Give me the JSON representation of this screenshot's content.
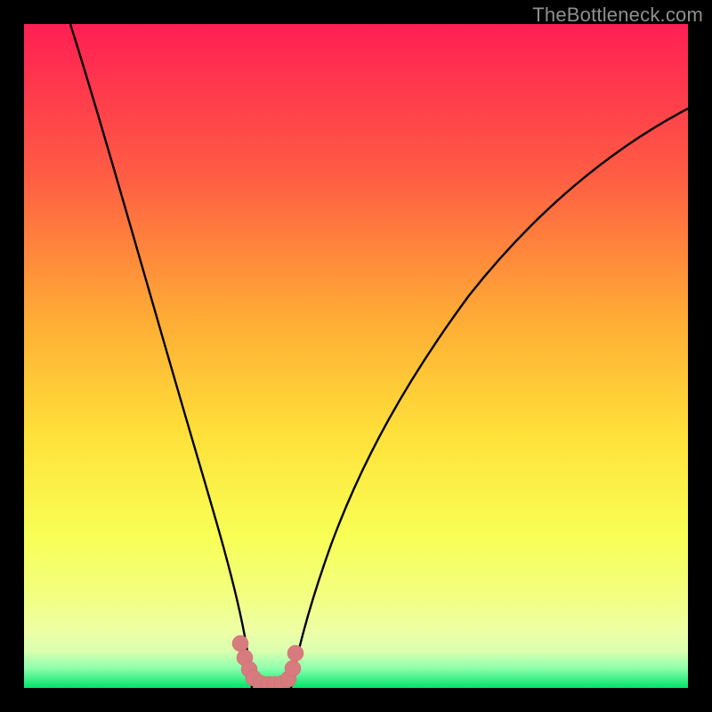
{
  "watermark": "TheBottleneck.com",
  "chart_data": {
    "type": "line",
    "title": "",
    "xlabel": "",
    "ylabel": "",
    "xlim": [
      0,
      100
    ],
    "ylim": [
      0,
      100
    ],
    "series": [
      {
        "name": "left-curve",
        "x": [
          7,
          10,
          14,
          18,
          22,
          25,
          27,
          29,
          30.5,
          31.5,
          32.3,
          33,
          33.5,
          34
        ],
        "y": [
          100,
          90,
          76,
          62,
          47,
          35,
          27,
          19,
          13,
          9,
          6,
          4,
          2.5,
          0
        ]
      },
      {
        "name": "right-curve",
        "x": [
          40,
          41,
          43,
          46,
          50,
          56,
          64,
          74,
          85,
          95,
          100
        ],
        "y": [
          0,
          3,
          10,
          20,
          32,
          46,
          60,
          72,
          80,
          85,
          88
        ]
      },
      {
        "name": "trough-markers",
        "type": "scatter",
        "x": [
          32.5,
          33.2,
          33.9,
          34.6,
          35.6,
          36.8,
          37.8,
          38.8,
          39.8,
          40.5,
          40.8
        ],
        "y": [
          6.8,
          4.6,
          2.8,
          1.4,
          0.6,
          0.5,
          0.5,
          0.6,
          1.3,
          3.0,
          5.2
        ]
      }
    ],
    "colors": {
      "curve": "#000000",
      "markers": "#d87b7e",
      "bottom_bar": "#00e36a",
      "bottom_halo": "#e9fd9e"
    },
    "background_gradient": {
      "top": "#ff1f54",
      "mid_upper": "#ff7a3a",
      "mid": "#ffd53a",
      "mid_lower": "#f6ff60",
      "lower": "#e9fd9e",
      "bottom": "#00e36a"
    }
  }
}
